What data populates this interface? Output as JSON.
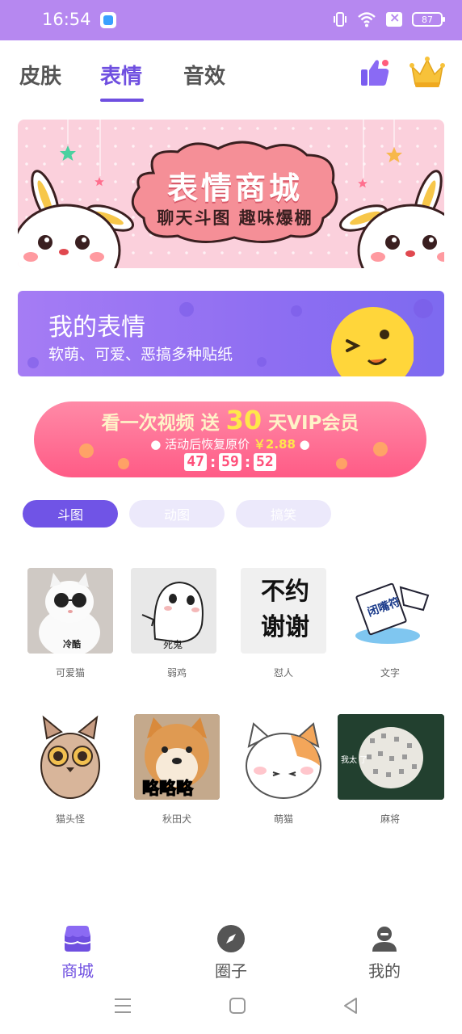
{
  "status_bar": {
    "time": "16:54",
    "battery": "87"
  },
  "tabs": [
    {
      "label": "皮肤",
      "active": false
    },
    {
      "label": "表情",
      "active": true
    },
    {
      "label": "音效",
      "active": false
    }
  ],
  "banner": {
    "title": "表情商城",
    "subtitle": "聊天斗图 趣味爆棚"
  },
  "my_stickers": {
    "title": "我的表情",
    "subtitle": "软萌、可爱、恶搞多种贴纸"
  },
  "vip_promo": {
    "line1_prefix": "看一次视频 送",
    "days": "30",
    "line1_suffix": "天VIP会员",
    "line2": "活动后恢复原价",
    "price": "￥2.88",
    "countdown": [
      "47",
      "59",
      "52"
    ]
  },
  "categories": [
    {
      "label": "斗图",
      "active": true
    },
    {
      "label": "动图",
      "active": false
    },
    {
      "label": "搞笑",
      "active": false
    }
  ],
  "stickers": [
    {
      "label": "可爱猫",
      "caption": "冷酷"
    },
    {
      "label": "弱鸡",
      "caption": "死鬼"
    },
    {
      "label": "怼人",
      "caption": "不约 谢谢"
    },
    {
      "label": "文字",
      "caption": "闭嘴符"
    },
    {
      "label": "猫头怪",
      "caption": ""
    },
    {
      "label": "秋田犬",
      "caption": "略略略"
    },
    {
      "label": "萌猫",
      "caption": ""
    },
    {
      "label": "麻将",
      "caption": "我太 了"
    }
  ],
  "bottom_nav": [
    {
      "label": "商城",
      "icon": "shop-icon",
      "active": true
    },
    {
      "label": "圈子",
      "icon": "compass-icon",
      "active": false
    },
    {
      "label": "我的",
      "icon": "user-icon",
      "active": false
    }
  ],
  "colors": {
    "accent": "#6f4fe0",
    "status_bar": "#b688f0",
    "vip": "#ff5b86"
  }
}
